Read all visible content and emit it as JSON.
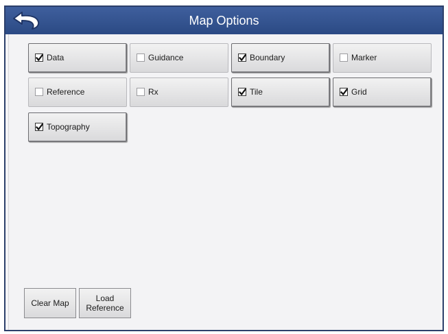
{
  "window": {
    "title": "Map Options",
    "back_icon": "back-arrow-icon"
  },
  "options": [
    {
      "label": "Data",
      "checked": true
    },
    {
      "label": "Guidance",
      "checked": false
    },
    {
      "label": "Boundary",
      "checked": true
    },
    {
      "label": "Marker",
      "checked": false
    },
    {
      "label": "Reference",
      "checked": false
    },
    {
      "label": "Rx",
      "checked": false
    },
    {
      "label": "Tile",
      "checked": true
    },
    {
      "label": "Grid",
      "checked": true
    },
    {
      "label": "Topography",
      "checked": true
    }
  ],
  "buttons": {
    "clear_map": "Clear Map",
    "load_reference_line1": "Load",
    "load_reference_line2": "Reference"
  },
  "colors": {
    "titlebar": "#2b4a84",
    "frame_border": "#2c3f6a",
    "background": "#f3f3f5"
  }
}
